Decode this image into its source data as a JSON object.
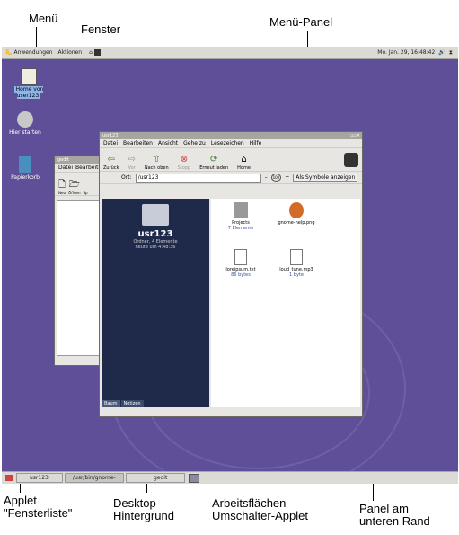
{
  "callouts": {
    "menu": "Menü",
    "window": "Fenster",
    "menu_panel": "Menü-Panel",
    "window_list_applet": "Applet \"Fensterliste\"",
    "desktop_background": "Desktop-Hintergrund",
    "workspace_switcher": "Arbeitsflächen-Umschalter-Applet",
    "bottom_panel": "Panel am unteren Rand"
  },
  "top_panel": {
    "applications": "Anwendungen",
    "actions": "Aktionen",
    "datetime": "Mo. Jan. 29, 16:48:42"
  },
  "desktop_icons": [
    {
      "label": "Home von user123",
      "selected": true
    },
    {
      "label": "Hier starten"
    },
    {
      "label": "Papierkorb"
    }
  ],
  "bg_window": {
    "title": "gedit",
    "menu": [
      "Datei",
      "Bearbeite"
    ],
    "toolbar": [
      "Neu",
      "Öffnen",
      "Sp"
    ]
  },
  "nautilus": {
    "title": "usr123",
    "menu": [
      "Datei",
      "Bearbeiten",
      "Ansicht",
      "Gehe zu",
      "Lesezeichen",
      "Hilfe"
    ],
    "toolbar": [
      {
        "icon": "arrow-left-icon",
        "label": "Zurück"
      },
      {
        "icon": "arrow-right-icon",
        "label": "Vor"
      },
      {
        "icon": "arrow-up-icon",
        "label": "Nach oben"
      },
      {
        "icon": "stop-icon",
        "label": "Stopp"
      },
      {
        "icon": "reload-icon",
        "label": "Erneut laden"
      },
      {
        "icon": "home-icon",
        "label": "Home"
      }
    ],
    "location_label": "Ort:",
    "location_value": "/usr123",
    "zoom": "100",
    "view_mode": "Als Symbole anzeigen",
    "side": {
      "name": "usr123",
      "info": "Ordner, 4 Elemente",
      "date": "heute um 4:48:36",
      "tabs": [
        "Baum",
        "Notizen"
      ]
    },
    "files": [
      {
        "name": "Projects",
        "sub": "7 Elemente"
      },
      {
        "name": "gnome-help.png",
        "sub": ""
      },
      {
        "name": "loreipsum.txt",
        "sub": "86 bytes"
      },
      {
        "name": "loud_tune.mp3",
        "sub": "1 byte"
      }
    ]
  },
  "bottom_panel": {
    "tasks": [
      "usr123",
      "/usr/bin/gnome-panel-",
      "gedit"
    ]
  }
}
